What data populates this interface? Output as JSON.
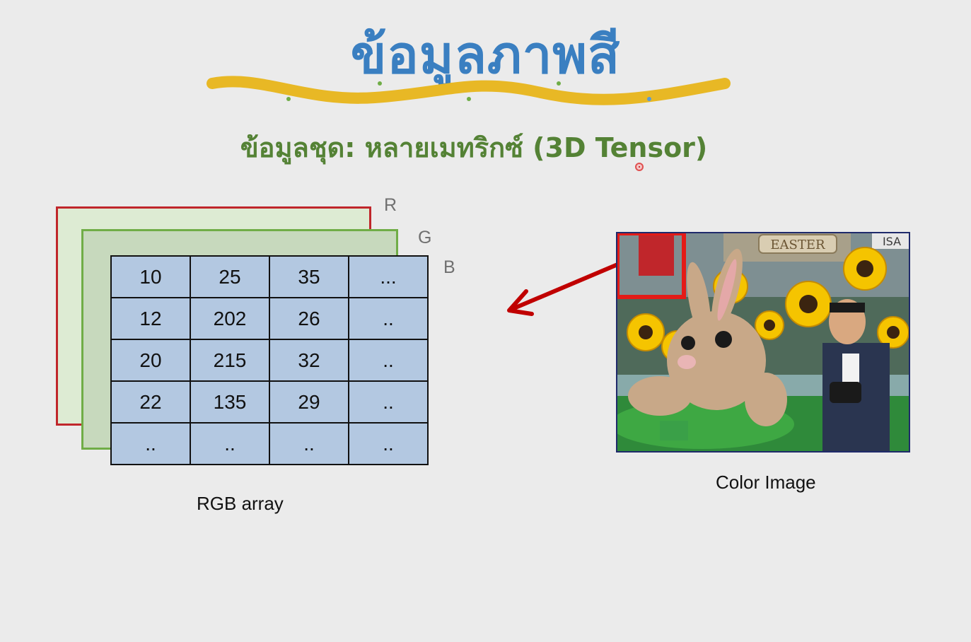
{
  "title": "ข้อมูลภาพสี",
  "subtitle": "ข้อมูลชุด: หลายเมทริกซ์ (3D Tensor)",
  "channel_labels": {
    "r": "R",
    "g": "G",
    "b": "B"
  },
  "matrix": {
    "rows": [
      [
        "10",
        "25",
        "35",
        "..."
      ],
      [
        "12",
        "202",
        "26",
        ".."
      ],
      [
        "20",
        "215",
        "32",
        ".."
      ],
      [
        "22",
        "135",
        "29",
        ".."
      ],
      [
        "..",
        "..",
        "..",
        ".."
      ]
    ]
  },
  "captions": {
    "array": "RGB array",
    "image": "Color Image"
  },
  "photo_sign_text": "EASTER",
  "photo_sign_text_right": "ISA",
  "colors": {
    "title": "#3a7fc1",
    "subtitle": "#548235",
    "wave": "#e8b825",
    "red_frame": "#c0262b",
    "green_frame": "#70ad47",
    "grid_fill": "#b3c8e1",
    "arrow": "#c00000"
  }
}
